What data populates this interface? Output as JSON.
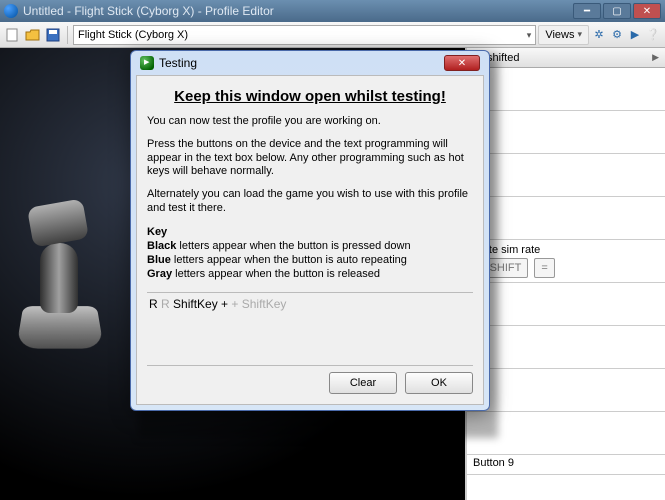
{
  "titlebar": {
    "title": "Untitled - Flight Stick (Cyborg X) - Profile Editor"
  },
  "toolbar": {
    "device": "Flight Stick (Cyborg X)",
    "views_label": "Views"
  },
  "right_panel": {
    "mode_label": "Unshifted",
    "row_text": "erate sim rate",
    "btn_shift": "T SHIFT",
    "btn_eq": "=",
    "last_label": "Button 9"
  },
  "dialog": {
    "title": "Testing",
    "heading": "Keep this window open whilst testing!",
    "p1": "You can now test the profile you are working on.",
    "p2": "Press the buttons on the device and the text programming will appear in the text box below. Any other programming such as hot keys will behave normally.",
    "p3": "Alternately you can load the game you wish to use with this profile and test it there.",
    "legend_key": "Key",
    "legend_black_bold": "Black",
    "legend_black_rest": " letters appear when the button is pressed down",
    "legend_blue_bold": "Blue",
    "legend_blue_rest": " letters appear when the button is auto repeating",
    "legend_gray_bold": "Gray",
    "legend_gray_rest": " letters appear when the button is released",
    "output_press1": "R",
    "output_rel1": " R ",
    "output_press2": "ShiftKey +",
    "output_rel2": " + ShiftKey",
    "btn_clear": "Clear",
    "btn_ok": "OK"
  }
}
